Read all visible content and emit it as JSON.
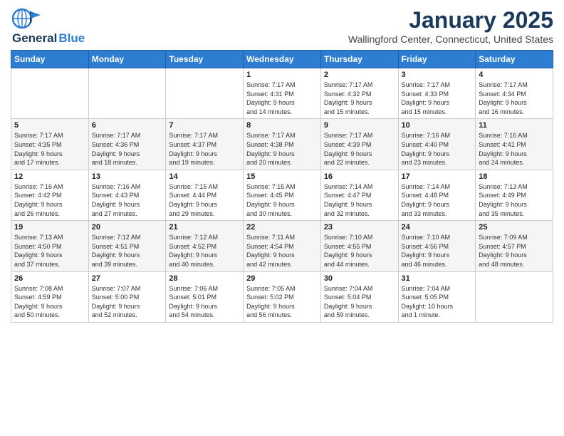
{
  "header": {
    "logo_line1": "General",
    "logo_line2": "Blue",
    "title": "January 2025",
    "subtitle": "Wallingford Center, Connecticut, United States"
  },
  "calendar": {
    "days_of_week": [
      "Sunday",
      "Monday",
      "Tuesday",
      "Wednesday",
      "Thursday",
      "Friday",
      "Saturday"
    ],
    "weeks": [
      [
        {
          "day": "",
          "info": ""
        },
        {
          "day": "",
          "info": ""
        },
        {
          "day": "",
          "info": ""
        },
        {
          "day": "1",
          "info": "Sunrise: 7:17 AM\nSunset: 4:31 PM\nDaylight: 9 hours\nand 14 minutes."
        },
        {
          "day": "2",
          "info": "Sunrise: 7:17 AM\nSunset: 4:32 PM\nDaylight: 9 hours\nand 15 minutes."
        },
        {
          "day": "3",
          "info": "Sunrise: 7:17 AM\nSunset: 4:33 PM\nDaylight: 9 hours\nand 15 minutes."
        },
        {
          "day": "4",
          "info": "Sunrise: 7:17 AM\nSunset: 4:34 PM\nDaylight: 9 hours\nand 16 minutes."
        }
      ],
      [
        {
          "day": "5",
          "info": "Sunrise: 7:17 AM\nSunset: 4:35 PM\nDaylight: 9 hours\nand 17 minutes."
        },
        {
          "day": "6",
          "info": "Sunrise: 7:17 AM\nSunset: 4:36 PM\nDaylight: 9 hours\nand 18 minutes."
        },
        {
          "day": "7",
          "info": "Sunrise: 7:17 AM\nSunset: 4:37 PM\nDaylight: 9 hours\nand 19 minutes."
        },
        {
          "day": "8",
          "info": "Sunrise: 7:17 AM\nSunset: 4:38 PM\nDaylight: 9 hours\nand 20 minutes."
        },
        {
          "day": "9",
          "info": "Sunrise: 7:17 AM\nSunset: 4:39 PM\nDaylight: 9 hours\nand 22 minutes."
        },
        {
          "day": "10",
          "info": "Sunrise: 7:16 AM\nSunset: 4:40 PM\nDaylight: 9 hours\nand 23 minutes."
        },
        {
          "day": "11",
          "info": "Sunrise: 7:16 AM\nSunset: 4:41 PM\nDaylight: 9 hours\nand 24 minutes."
        }
      ],
      [
        {
          "day": "12",
          "info": "Sunrise: 7:16 AM\nSunset: 4:42 PM\nDaylight: 9 hours\nand 26 minutes."
        },
        {
          "day": "13",
          "info": "Sunrise: 7:16 AM\nSunset: 4:43 PM\nDaylight: 9 hours\nand 27 minutes."
        },
        {
          "day": "14",
          "info": "Sunrise: 7:15 AM\nSunset: 4:44 PM\nDaylight: 9 hours\nand 29 minutes."
        },
        {
          "day": "15",
          "info": "Sunrise: 7:15 AM\nSunset: 4:45 PM\nDaylight: 9 hours\nand 30 minutes."
        },
        {
          "day": "16",
          "info": "Sunrise: 7:14 AM\nSunset: 4:47 PM\nDaylight: 9 hours\nand 32 minutes."
        },
        {
          "day": "17",
          "info": "Sunrise: 7:14 AM\nSunset: 4:48 PM\nDaylight: 9 hours\nand 33 minutes."
        },
        {
          "day": "18",
          "info": "Sunrise: 7:13 AM\nSunset: 4:49 PM\nDaylight: 9 hours\nand 35 minutes."
        }
      ],
      [
        {
          "day": "19",
          "info": "Sunrise: 7:13 AM\nSunset: 4:50 PM\nDaylight: 9 hours\nand 37 minutes."
        },
        {
          "day": "20",
          "info": "Sunrise: 7:12 AM\nSunset: 4:51 PM\nDaylight: 9 hours\nand 39 minutes."
        },
        {
          "day": "21",
          "info": "Sunrise: 7:12 AM\nSunset: 4:52 PM\nDaylight: 9 hours\nand 40 minutes."
        },
        {
          "day": "22",
          "info": "Sunrise: 7:11 AM\nSunset: 4:54 PM\nDaylight: 9 hours\nand 42 minutes."
        },
        {
          "day": "23",
          "info": "Sunrise: 7:10 AM\nSunset: 4:55 PM\nDaylight: 9 hours\nand 44 minutes."
        },
        {
          "day": "24",
          "info": "Sunrise: 7:10 AM\nSunset: 4:56 PM\nDaylight: 9 hours\nand 46 minutes."
        },
        {
          "day": "25",
          "info": "Sunrise: 7:09 AM\nSunset: 4:57 PM\nDaylight: 9 hours\nand 48 minutes."
        }
      ],
      [
        {
          "day": "26",
          "info": "Sunrise: 7:08 AM\nSunset: 4:59 PM\nDaylight: 9 hours\nand 50 minutes."
        },
        {
          "day": "27",
          "info": "Sunrise: 7:07 AM\nSunset: 5:00 PM\nDaylight: 9 hours\nand 52 minutes."
        },
        {
          "day": "28",
          "info": "Sunrise: 7:06 AM\nSunset: 5:01 PM\nDaylight: 9 hours\nand 54 minutes."
        },
        {
          "day": "29",
          "info": "Sunrise: 7:05 AM\nSunset: 5:02 PM\nDaylight: 9 hours\nand 56 minutes."
        },
        {
          "day": "30",
          "info": "Sunrise: 7:04 AM\nSunset: 5:04 PM\nDaylight: 9 hours\nand 59 minutes."
        },
        {
          "day": "31",
          "info": "Sunrise: 7:04 AM\nSunset: 5:05 PM\nDaylight: 10 hours\nand 1 minute."
        },
        {
          "day": "",
          "info": ""
        }
      ]
    ]
  }
}
